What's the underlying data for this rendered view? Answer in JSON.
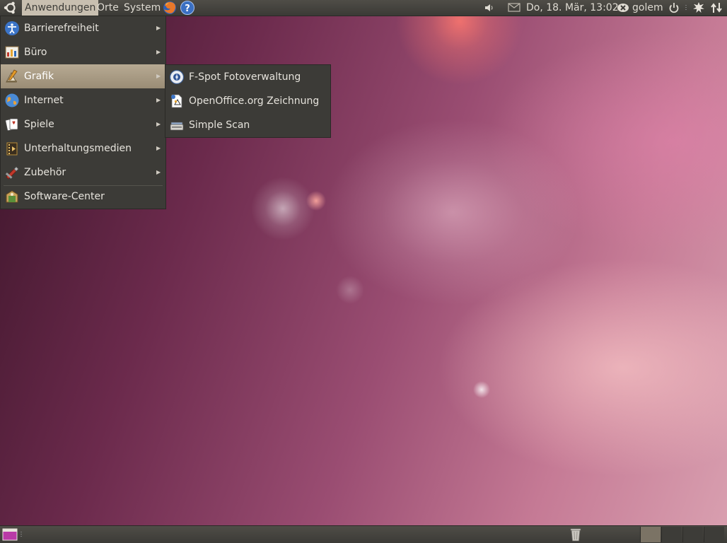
{
  "top_panel": {
    "menus": [
      "Anwendungen",
      "Orte",
      "System"
    ],
    "launchers": [
      "firefox",
      "help"
    ],
    "clock": "Do, 18. Mär, 13:02",
    "user": "golem"
  },
  "applications_menu": {
    "items": [
      {
        "label": "Barrierefreiheit",
        "icon": "accessibility-icon",
        "has_submenu": true
      },
      {
        "label": "Büro",
        "icon": "office-icon",
        "has_submenu": true
      },
      {
        "label": "Grafik",
        "icon": "graphics-icon",
        "has_submenu": true,
        "active": true
      },
      {
        "label": "Internet",
        "icon": "internet-globe-icon",
        "has_submenu": true
      },
      {
        "label": "Spiele",
        "icon": "games-cards-icon",
        "has_submenu": true
      },
      {
        "label": "Unterhaltungsmedien",
        "icon": "multimedia-icon",
        "has_submenu": true
      },
      {
        "label": "Zubehör",
        "icon": "accessories-icon",
        "has_submenu": true
      },
      {
        "label": "Software-Center",
        "icon": "software-center-icon",
        "has_submenu": false
      }
    ]
  },
  "grafik_submenu": {
    "items": [
      {
        "label": "F-Spot Fotoverwaltung",
        "icon": "f-spot-icon"
      },
      {
        "label": "OpenOffice.org Zeichnung",
        "icon": "draw-icon"
      },
      {
        "label": "Simple Scan",
        "icon": "scanner-icon"
      }
    ]
  },
  "bottom_panel": {
    "workspaces": 4,
    "current_workspace": 1
  },
  "colors": {
    "panel": "#3c3b37",
    "menu_highlight": "#a99c84",
    "menu_text": "#e6e3dc"
  }
}
